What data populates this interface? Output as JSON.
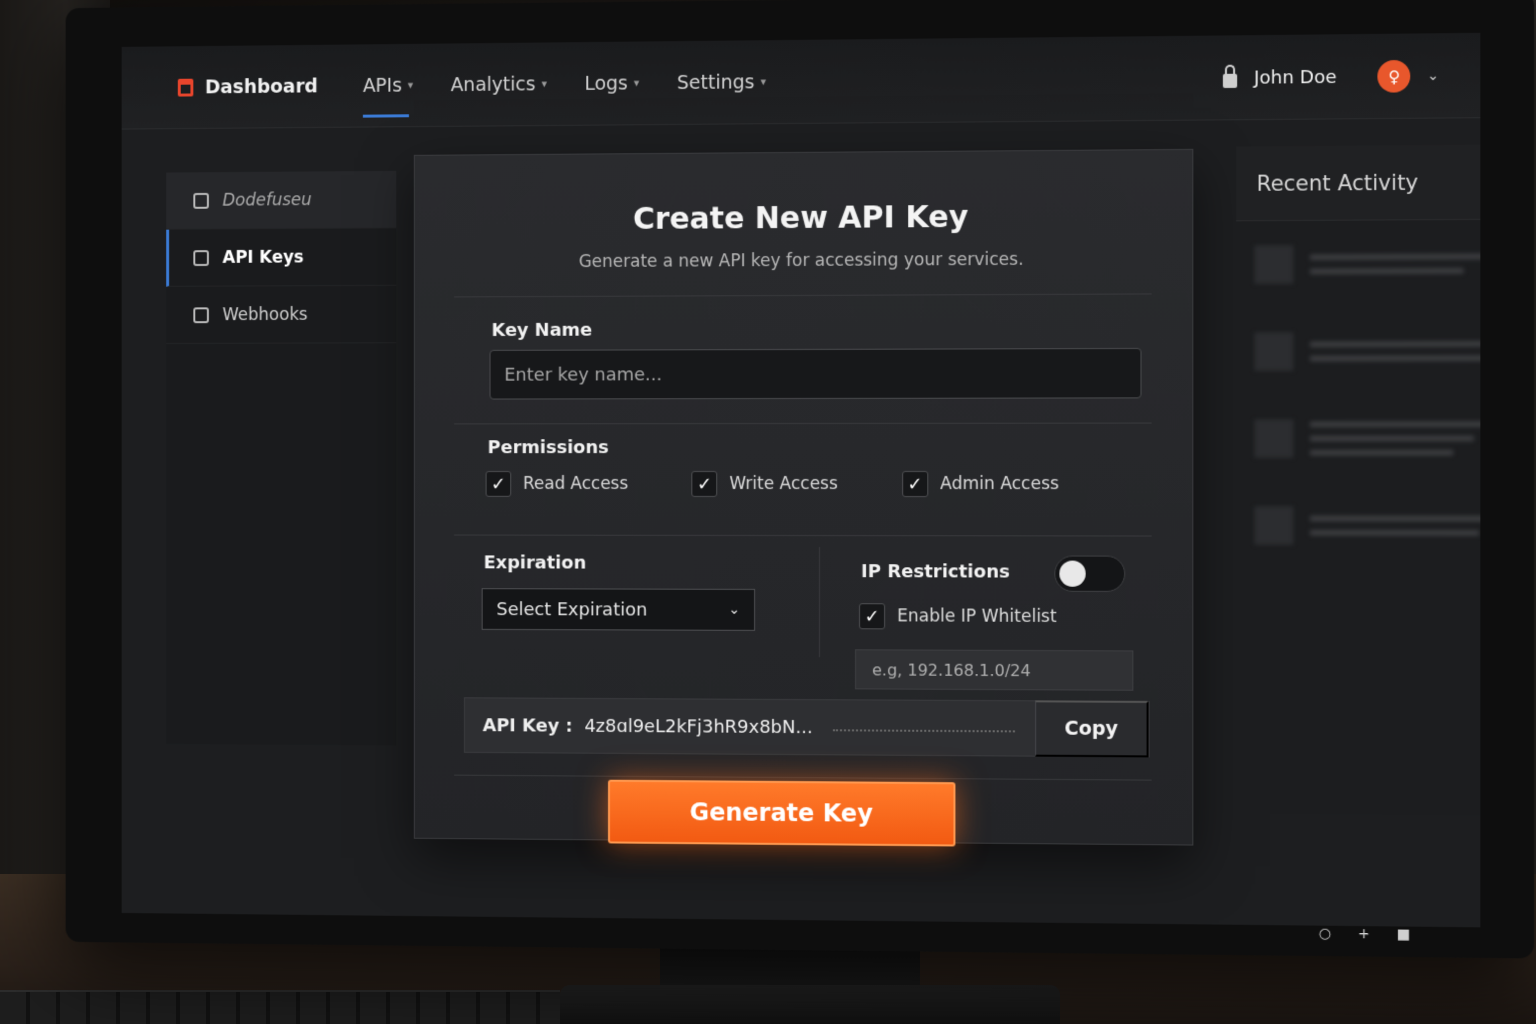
{
  "topnav": {
    "brand": "Dashboard",
    "items": [
      {
        "label": "APIs",
        "active": true
      },
      {
        "label": "Analytics",
        "active": false
      },
      {
        "label": "Logs",
        "active": false
      },
      {
        "label": "Settings",
        "active": false
      }
    ],
    "user_name": "John Doe",
    "icons": {
      "brand": "dashboard-icon",
      "lock": "lock-icon",
      "avatar": "user-avatar-icon",
      "chevron": "chevron-down-icon"
    }
  },
  "sidebar": {
    "items": [
      {
        "label": "Dodefuseu"
      },
      {
        "label": "API Keys"
      },
      {
        "label": "Webhooks"
      }
    ]
  },
  "form": {
    "title": "Create New API Key",
    "subtitle": "Generate a new API key for accessing your services.",
    "key_name_label": "Key Name",
    "key_name_placeholder": "Enter key name...",
    "key_name_value": "",
    "permissions_label": "Permissions",
    "permissions": [
      {
        "label": "Read Access",
        "checked": true
      },
      {
        "label": "Write Access",
        "checked": true
      },
      {
        "label": "Admin Access",
        "checked": true
      }
    ],
    "expiration_label": "Expiration",
    "expiration_value": "Select Expiration",
    "ip_label": "IP Restrictions",
    "ip_toggle_on": false,
    "ip_whitelist_label": "Enable IP Whitelist",
    "ip_whitelist_checked": true,
    "ip_placeholder": "e.g, 192.168.1.0/24",
    "api_key_label": "API Key :",
    "api_key_value": "4z8ɑl9eL2kFj3hR9x8bN...",
    "copy_label": "Copy",
    "generate_label": "Generate Key"
  },
  "activity": {
    "title": "Recent Activity"
  },
  "colors": {
    "accent": "#f25a12",
    "nav_active": "#3b7bd6",
    "background": "#1d1e20"
  }
}
